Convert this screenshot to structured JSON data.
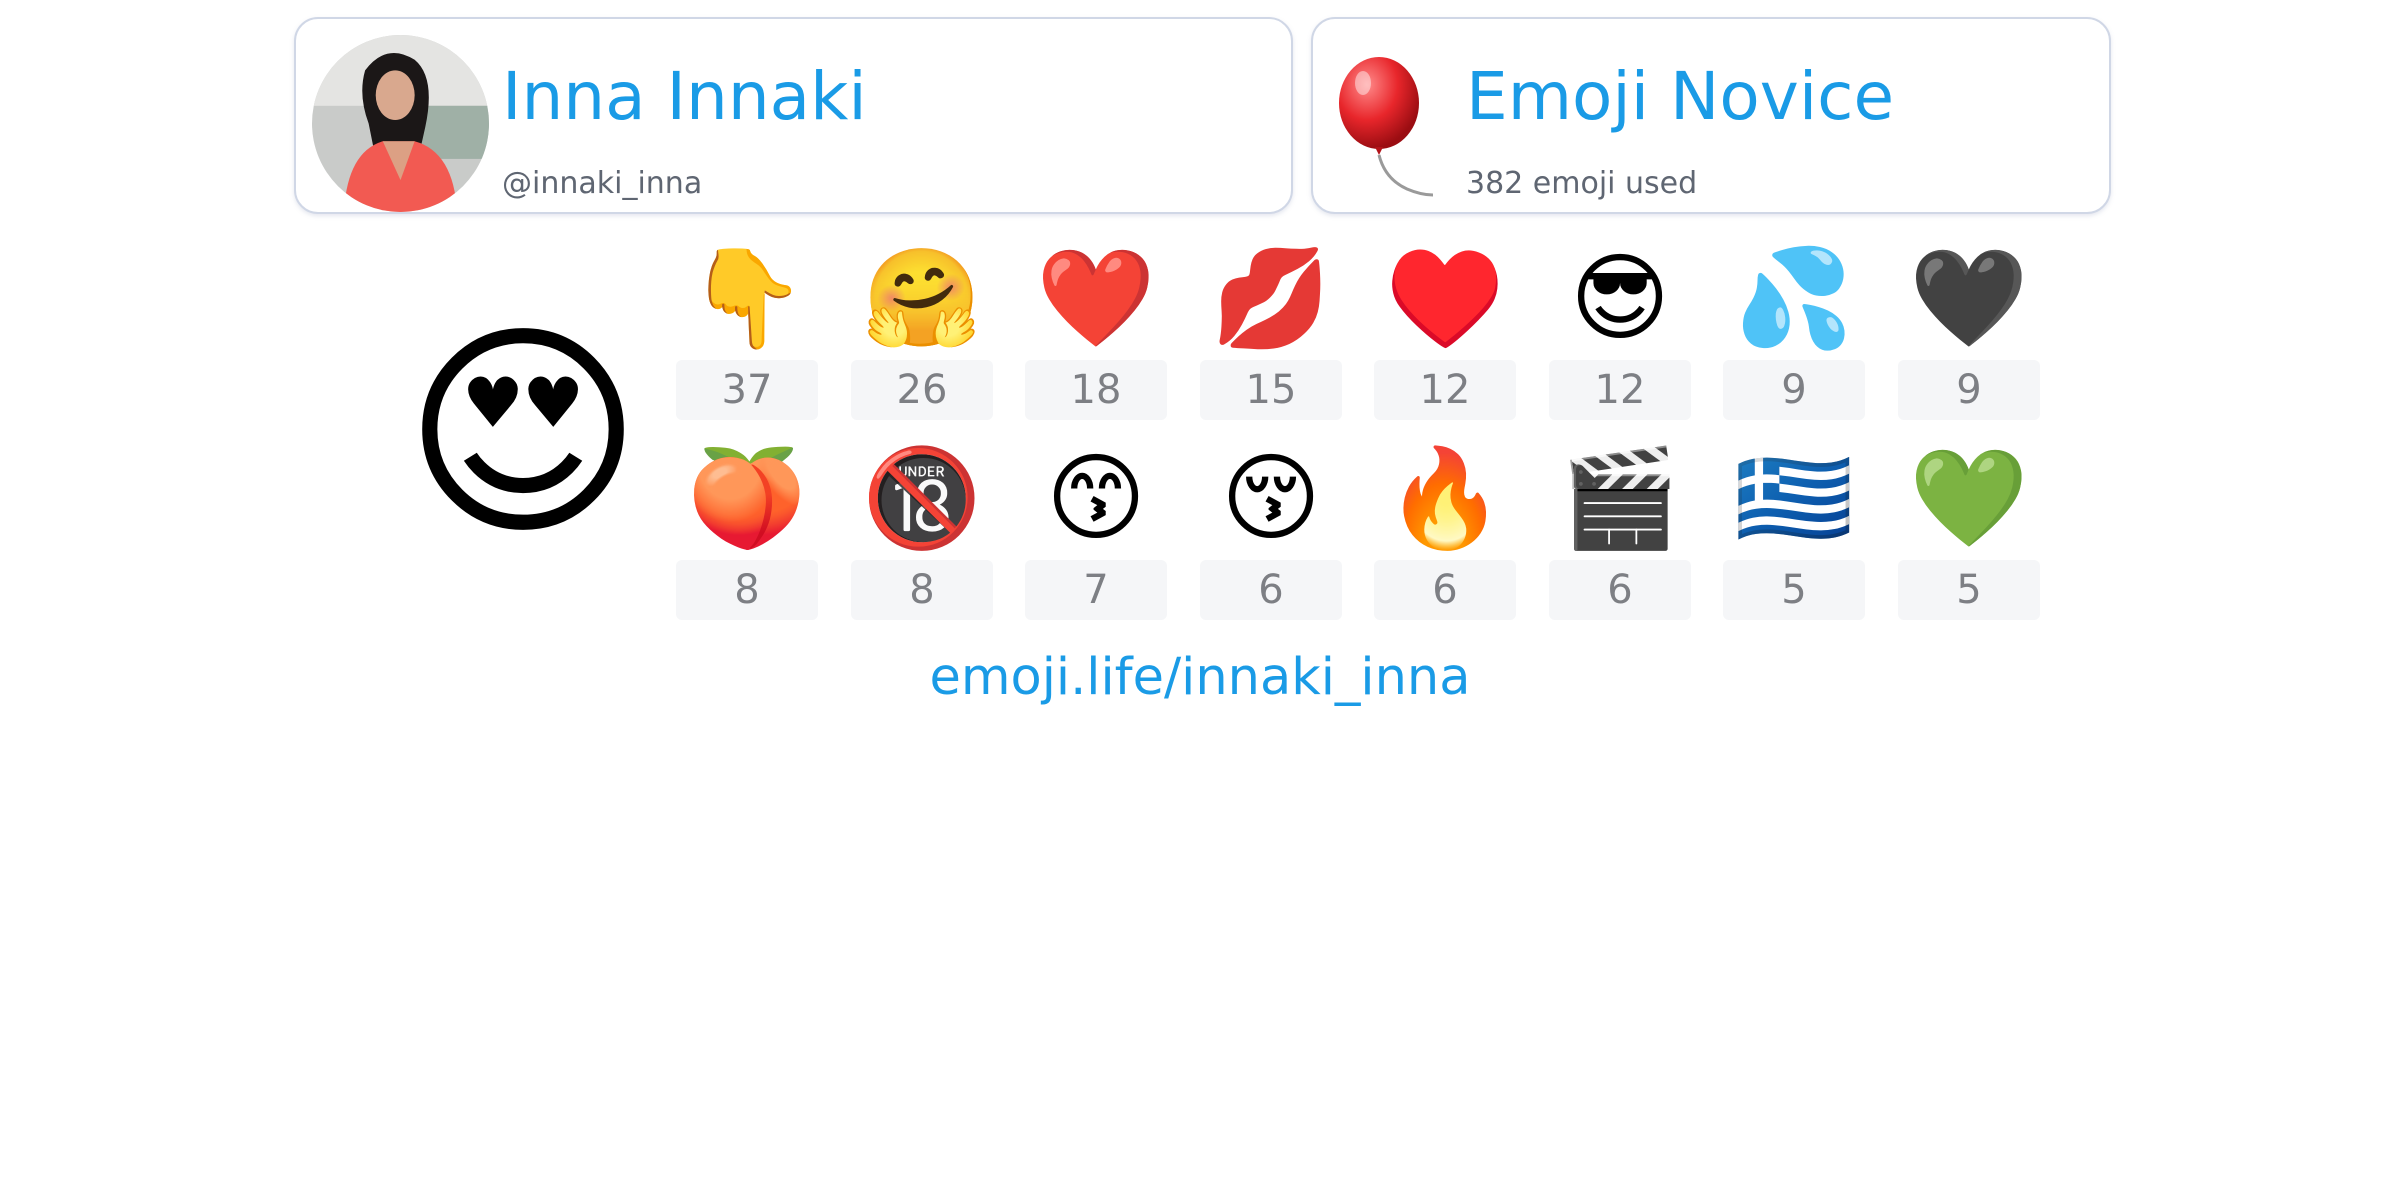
{
  "profile": {
    "name": "Inna Innaki",
    "handle": "@innaki_inna"
  },
  "rank": {
    "title": "Emoji Novice",
    "subtitle": "382 emoji used",
    "icon": "balloon-icon"
  },
  "top_emoji": "😍",
  "emoji_stats": [
    {
      "emoji": "👇",
      "count": "37"
    },
    {
      "emoji": "🤗",
      "count": "26"
    },
    {
      "emoji": "❤️",
      "count": "18"
    },
    {
      "emoji": "💋",
      "count": "15"
    },
    {
      "emoji": "♥️",
      "count": "12"
    },
    {
      "emoji": "😎",
      "count": "12"
    },
    {
      "emoji": "💦",
      "count": "9"
    },
    {
      "emoji": "🖤",
      "count": "9"
    },
    {
      "emoji": "🍑",
      "count": "8"
    },
    {
      "emoji": "🔞",
      "count": "8"
    },
    {
      "emoji": "😙",
      "count": "7"
    },
    {
      "emoji": "😚",
      "count": "6"
    },
    {
      "emoji": "🔥",
      "count": "6"
    },
    {
      "emoji": "🎬",
      "count": "6"
    },
    {
      "emoji": "🇬🇷",
      "count": "5"
    },
    {
      "emoji": "💚",
      "count": "5"
    }
  ],
  "footer": {
    "link": "emoji.life/innaki_inna"
  },
  "colors": {
    "accent": "#1a9be6",
    "card_border": "#d0d7e6",
    "count_bg": "#f5f6f8",
    "count_text": "#7d7f84"
  }
}
